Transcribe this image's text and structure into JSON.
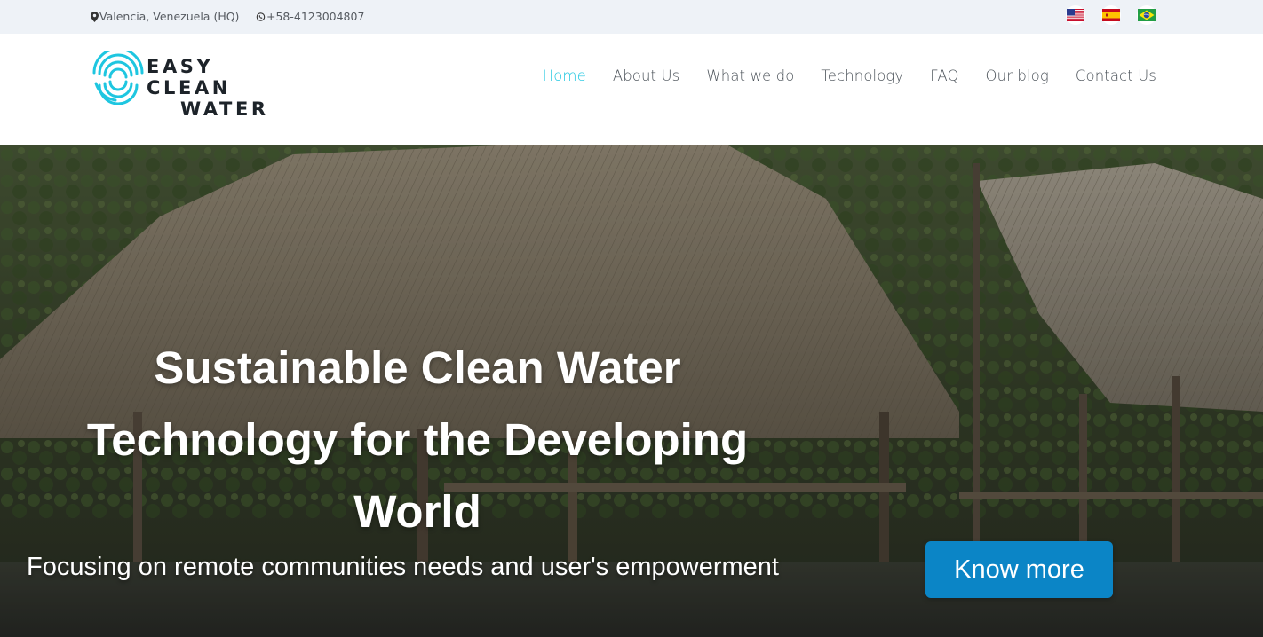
{
  "topbar": {
    "location": "Valencia, Venezuela (HQ)",
    "phone": "+58-4123004807",
    "languages": [
      {
        "name": "English",
        "icon": "us-flag-icon"
      },
      {
        "name": "Español",
        "icon": "spain-flag-icon"
      },
      {
        "name": "Português",
        "icon": "brazil-flag-icon"
      }
    ]
  },
  "brand": {
    "line1": "EASY CLEAN",
    "line2": "WATER",
    "accent_color": "#1ec6e0"
  },
  "nav": {
    "items": [
      {
        "label": "Home",
        "active": true
      },
      {
        "label": "About Us",
        "active": false
      },
      {
        "label": "What we do",
        "active": false
      },
      {
        "label": "Technology",
        "active": false
      },
      {
        "label": "FAQ",
        "active": false
      },
      {
        "label": "Our blog",
        "active": false
      },
      {
        "label": "Contact Us",
        "active": false
      }
    ]
  },
  "hero": {
    "title": "Sustainable Clean Water Technology for the Developing World",
    "subtitle": "Focusing on remote communities needs and user's empowerment",
    "cta_label": "Know more",
    "cta_color": "#0b85c6"
  }
}
